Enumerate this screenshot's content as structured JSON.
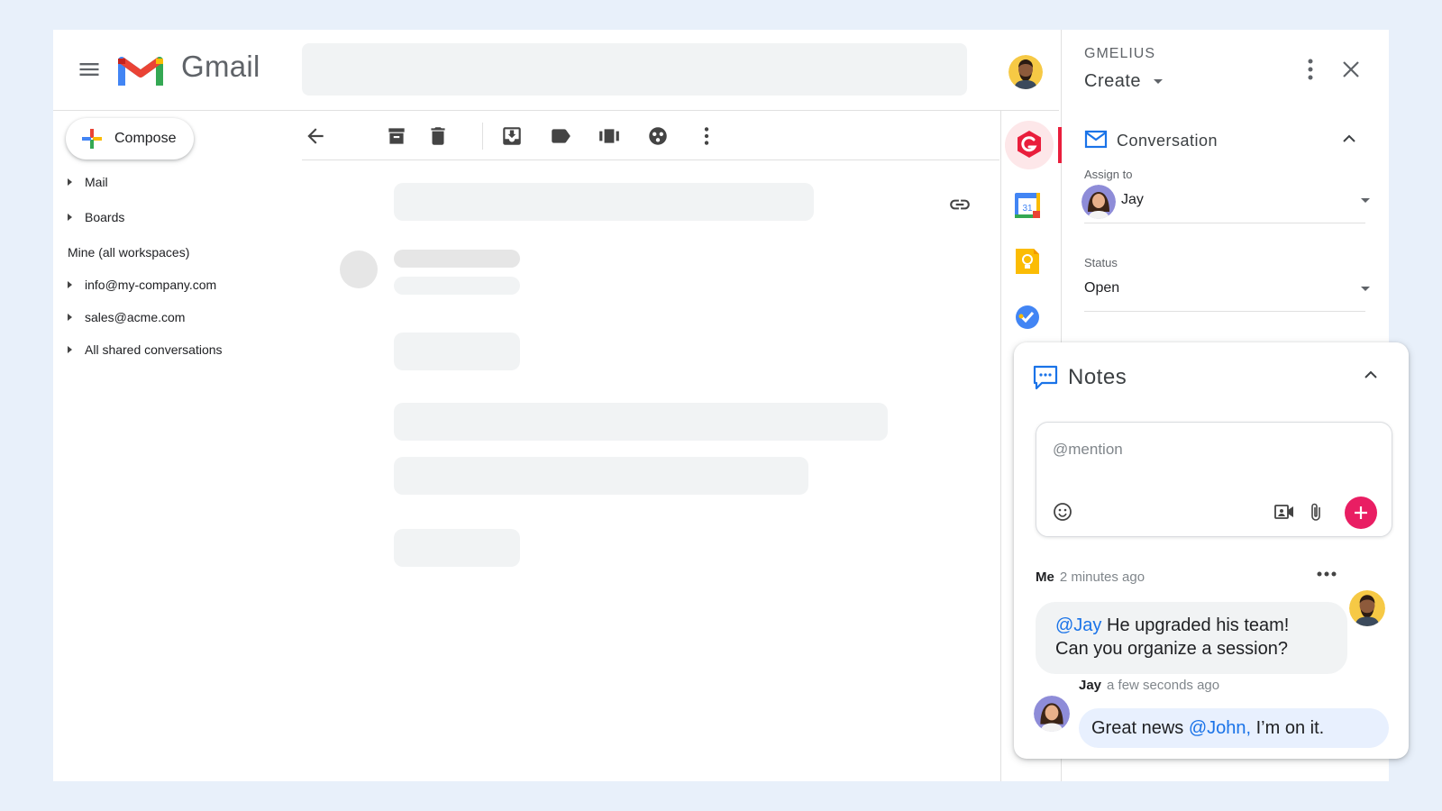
{
  "header": {
    "app_name": "Gmail",
    "menu_icon": "hamburger-menu-icon",
    "search_placeholder": ""
  },
  "sidebar": {
    "compose_label": "Compose",
    "items": [
      {
        "label": "Mail"
      },
      {
        "label": "Boards"
      }
    ],
    "section_heading": "Mine (all workspaces)",
    "shared_items": [
      {
        "label": "info@my-company.com"
      },
      {
        "label": "sales@acme.com"
      },
      {
        "label": "All shared conversations"
      }
    ]
  },
  "toolbar": {
    "icons": [
      "back-arrow-icon",
      "archive-icon",
      "delete-icon",
      "move-to-inbox-icon",
      "label-icon",
      "board-icon",
      "snooze-icon",
      "more-vert-icon"
    ]
  },
  "side_apps": [
    "gmelius-icon",
    "calendar-icon",
    "keep-icon",
    "tasks-icon"
  ],
  "gmelius": {
    "title": "GMELIUS",
    "create_label": "Create",
    "conversation_title": "Conversation",
    "assign_label": "Assign to",
    "assignee": "Jay",
    "status_label": "Status",
    "status_value": "Open"
  },
  "notes": {
    "title": "Notes",
    "placeholder": "@mention",
    "messages": [
      {
        "author": "Me",
        "time": "2 minutes ago",
        "mention": "@Jay",
        "text_line1": " He upgraded his team!",
        "text_line2": "Can you organize a session?"
      },
      {
        "author": "Jay",
        "time": "a few seconds ago",
        "text_before": "Great news ",
        "mention": "@John,",
        "text_after": " I’m on it."
      }
    ]
  },
  "colors": {
    "background": "#e8f0fa",
    "accent_blue": "#1a73e8",
    "gmelius_red": "#e91e3c",
    "add_button": "#e91e63"
  }
}
